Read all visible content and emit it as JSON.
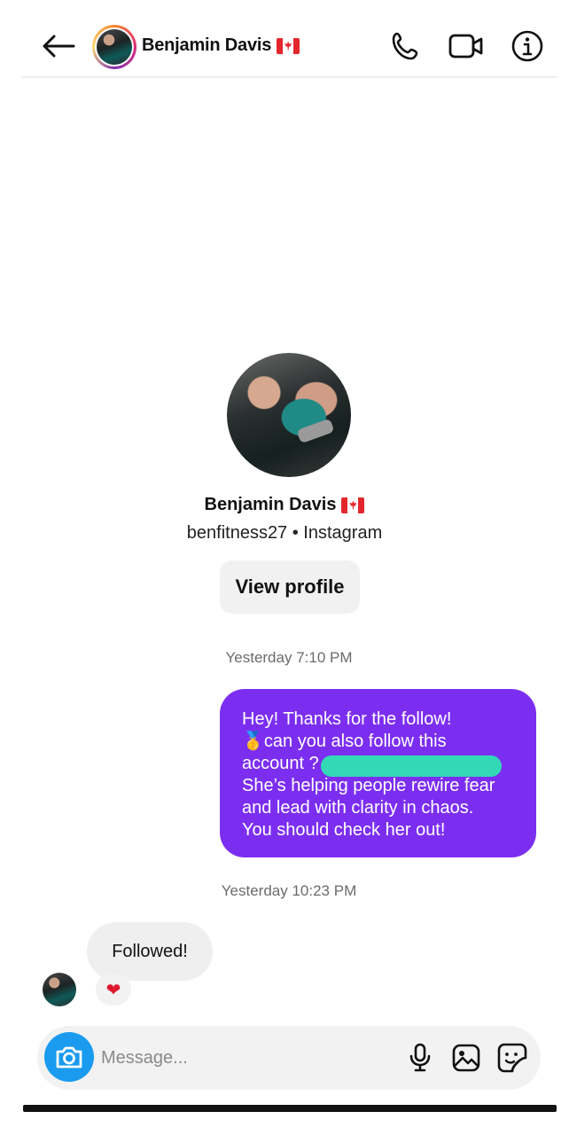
{
  "header": {
    "name": "Benjamin Davis",
    "flag": "canada-flag",
    "icons": [
      "back-arrow-icon",
      "phone-icon",
      "video-camera-icon",
      "info-icon"
    ]
  },
  "profile": {
    "name": "Benjamin Davis",
    "subtitle": "benfitness27 • Instagram",
    "view_profile_label": "View profile"
  },
  "conversation": {
    "timestamp_1": "Yesterday 7:10 PM",
    "outgoing_message": {
      "lines": [
        "Hey! Thanks for the follow!",
        "can you also follow this",
        "account ?",
        "She’s helping people rewire fear",
        "and lead with clarity in chaos.",
        "You should check her out!"
      ],
      "emoji": "🥇"
    },
    "timestamp_2": "Yesterday 10:23 PM",
    "incoming_message": "Followed!",
    "reaction": "❤"
  },
  "composer": {
    "placeholder": "Message...",
    "icons": [
      "camera-icon",
      "microphone-icon",
      "gallery-icon",
      "sticker-icon"
    ]
  },
  "colors": {
    "outgoing_bubble": "#7c2ef0",
    "camera_button": "#1a9bf0",
    "redaction": "#2fe3b3"
  }
}
